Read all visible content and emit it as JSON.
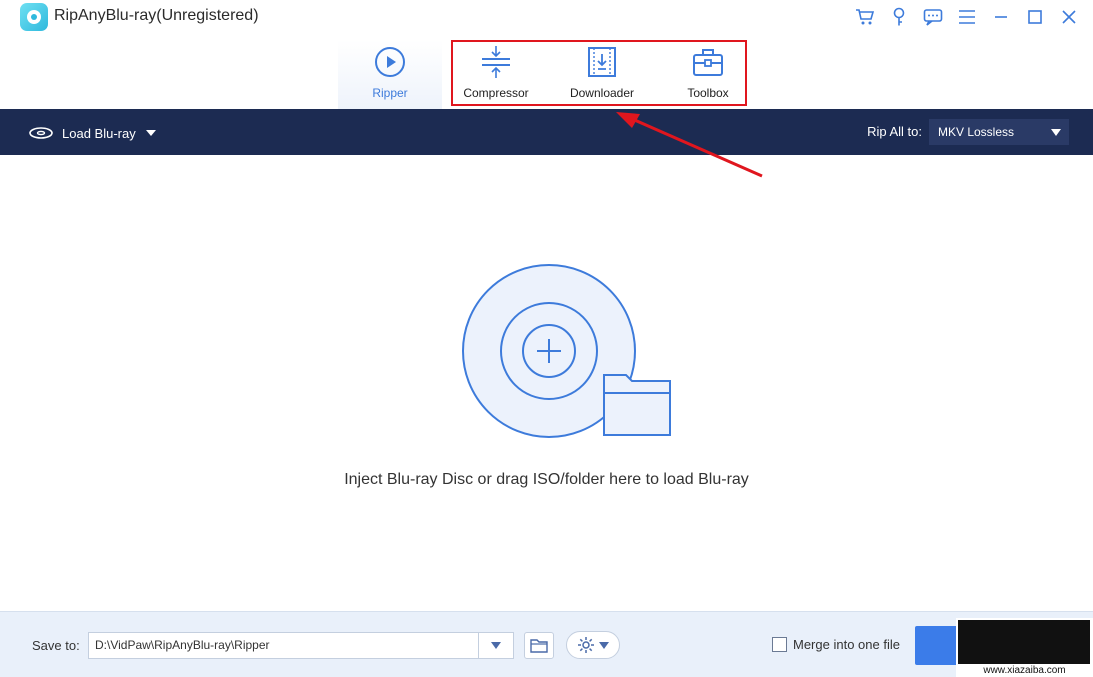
{
  "window": {
    "title": "RipAnyBlu-ray(Unregistered)"
  },
  "title_icons": [
    "cart-icon",
    "key-icon",
    "chat-icon",
    "menu-icon",
    "minimize-icon",
    "maximize-icon",
    "close-icon"
  ],
  "modules": {
    "tabs": [
      {
        "label": "Ripper",
        "icon": "play-icon",
        "active": true
      },
      {
        "label": "Compressor",
        "icon": "compress-icon",
        "active": false
      },
      {
        "label": "Downloader",
        "icon": "download-icon",
        "active": false
      },
      {
        "label": "Toolbox",
        "icon": "toolbox-icon",
        "active": false
      }
    ],
    "highlight_color": "#e0161e"
  },
  "toolbar": {
    "load_label": "Load Blu-ray",
    "rip_all_label": "Rip All to:",
    "format_value": "MKV Lossless",
    "bg_color": "#1c2b52"
  },
  "main": {
    "drop_hint": "Inject Blu-ray Disc or drag ISO/folder here to load Blu-ray",
    "accent": "#3d7bdb"
  },
  "bottom": {
    "save_label": "Save to:",
    "save_path": "D:\\VidPaw\\RipAnyBlu-ray\\Ripper",
    "merge_label": "Merge into one file",
    "merge_checked": false,
    "rip_button_color": "#3b7ce9"
  },
  "watermark": {
    "text": "www.xiazaiba.com"
  }
}
